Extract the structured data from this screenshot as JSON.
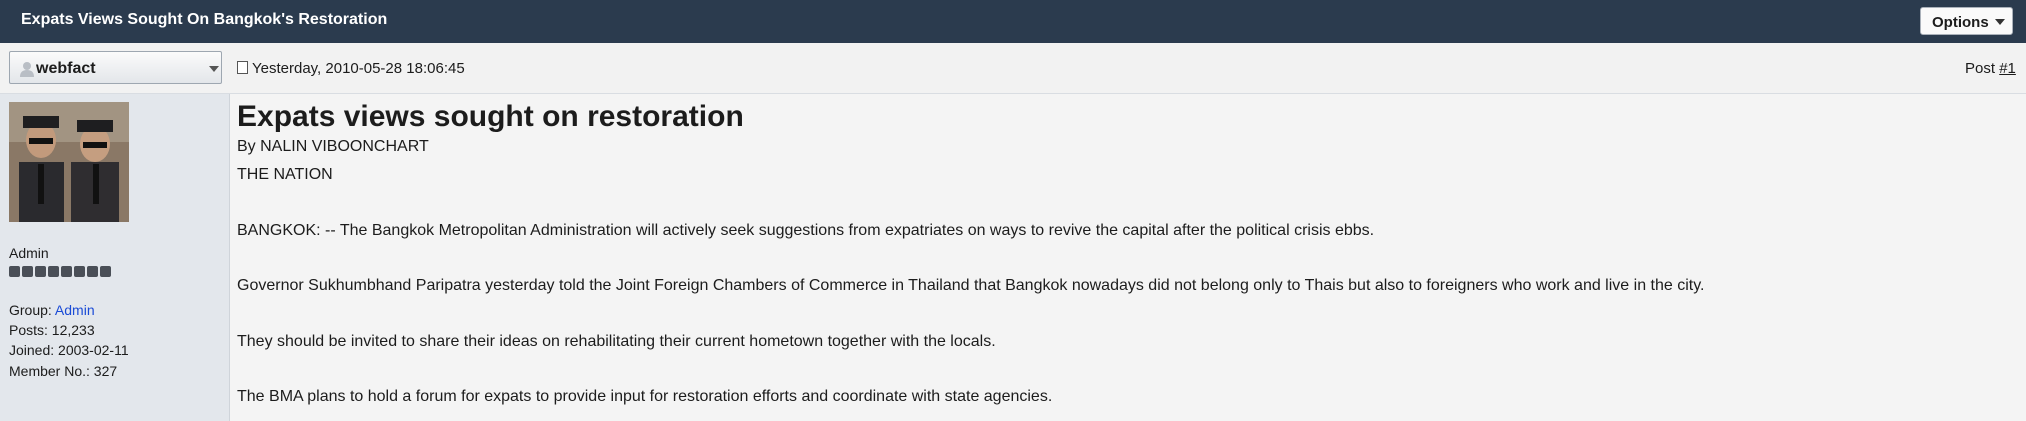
{
  "topbar": {
    "title": "Expats Views Sought On Bangkok's Restoration",
    "options_label": "Options"
  },
  "post": {
    "username": "webfact",
    "date": "Yesterday, 2010-05-28 18:06:45",
    "post_prefix": "Post ",
    "post_number": "#1"
  },
  "sidebar": {
    "role": "Admin",
    "pips": 8,
    "group_label": "Group: ",
    "group_value": "Admin",
    "posts": "Posts: 12,233",
    "joined": "Joined: 2003-02-11",
    "member_no": "Member No.: 327"
  },
  "article": {
    "headline": "Expats views sought on restoration",
    "byline": "By NALIN VIBOONCHART",
    "source": "THE NATION",
    "paragraphs": [
      "BANGKOK: -- The Bangkok Metropolitan Administration will actively seek suggestions from expatriates on ways to revive the capital after the political crisis ebbs.",
      "Governor Sukhumbhand Paripatra yesterday told the Joint Foreign Chambers of Commerce in Thailand that Bangkok nowadays did not belong only to Thais but also to foreigners who work and live in the city.",
      "They should be invited to share their ideas on rehabilitating their current hometown together with the locals.",
      "The BMA plans to hold a forum for expats to provide input for restoration efforts and coordinate with state agencies."
    ]
  }
}
